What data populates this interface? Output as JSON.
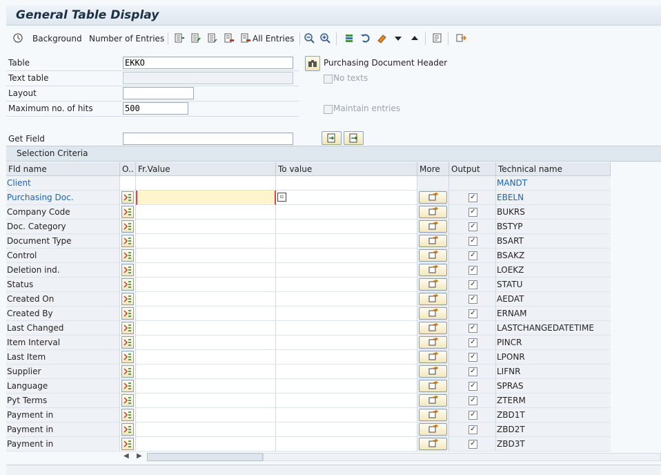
{
  "window": {
    "title": "General Table Display"
  },
  "toolbar": {
    "background_label": "Background",
    "entries_label": "Number of Entries",
    "all_entries_label": "All Entries"
  },
  "form": {
    "table_label": "Table",
    "table_value": "EKKO",
    "table_desc": "Purchasing Document Header",
    "text_table_label": "Text table",
    "text_table_value": "",
    "no_texts_label": "No texts",
    "layout_label": "Layout",
    "layout_value": "",
    "max_hits_label": "Maximum no. of hits",
    "max_hits_value": "500",
    "maintain_label": "Maintain entries",
    "get_field_label": "Get Field",
    "get_field_value": ""
  },
  "selection": {
    "title": "Selection Criteria",
    "headers": {
      "fld": "Fld name",
      "op": "O..",
      "from": "Fr.Value",
      "to": "To value",
      "more": "More",
      "output": "Output",
      "tech": "Technical name"
    },
    "rows": [
      {
        "fld": "Client",
        "tech": "MANDT",
        "link": true,
        "op": false,
        "output": false
      },
      {
        "fld": "Purchasing Doc.",
        "tech": "EBELN",
        "link": true,
        "op": true,
        "output": true,
        "active": true
      },
      {
        "fld": "Company Code",
        "tech": "BUKRS",
        "op": true,
        "output": true
      },
      {
        "fld": "Doc. Category",
        "tech": "BSTYP",
        "op": true,
        "output": true
      },
      {
        "fld": "Document Type",
        "tech": "BSART",
        "op": true,
        "output": true
      },
      {
        "fld": "Control",
        "tech": "BSAKZ",
        "op": true,
        "output": true
      },
      {
        "fld": "Deletion ind.",
        "tech": "LOEKZ",
        "op": true,
        "output": true
      },
      {
        "fld": "Status",
        "tech": "STATU",
        "op": true,
        "output": true
      },
      {
        "fld": "Created On",
        "tech": "AEDAT",
        "op": true,
        "output": true
      },
      {
        "fld": "Created By",
        "tech": "ERNAM",
        "op": true,
        "output": true
      },
      {
        "fld": "Last Changed",
        "tech": "LASTCHANGEDATETIME",
        "op": true,
        "output": true
      },
      {
        "fld": "Item Interval",
        "tech": "PINCR",
        "op": true,
        "output": true
      },
      {
        "fld": "Last Item",
        "tech": "LPONR",
        "op": true,
        "output": true
      },
      {
        "fld": "Supplier",
        "tech": "LIFNR",
        "op": true,
        "output": true
      },
      {
        "fld": "Language",
        "tech": "SPRAS",
        "op": true,
        "output": true
      },
      {
        "fld": "Pyt Terms",
        "tech": "ZTERM",
        "op": true,
        "output": true
      },
      {
        "fld": "Payment in",
        "tech": "ZBD1T",
        "op": true,
        "output": true
      },
      {
        "fld": "Payment in",
        "tech": "ZBD2T",
        "op": true,
        "output": true
      },
      {
        "fld": "Payment in",
        "tech": "ZBD3T",
        "op": true,
        "output": true
      }
    ]
  }
}
